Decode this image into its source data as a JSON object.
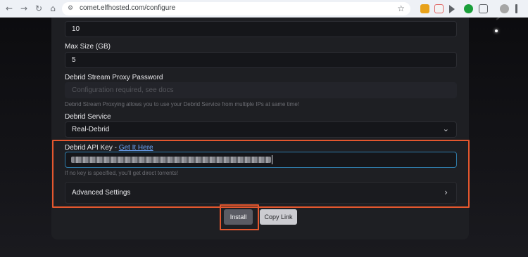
{
  "browser": {
    "url": "comet.elfhosted.com/configure",
    "back_glyph": "←",
    "forward_glyph": "→",
    "reload_glyph": "↻",
    "home_glyph": "⌂",
    "site_glyph": "⚙",
    "bookmark_glyph": "☆"
  },
  "form": {
    "top_field_value": "10",
    "max_size_label": "Max Size (GB)",
    "max_size_value": "5",
    "proxy_password_label": "Debrid Stream Proxy Password",
    "proxy_password_placeholder": "Configuration required, see docs",
    "proxy_hint": "Debrid Stream Proxying allows you to use your Debrid Service from multiple IPs at same time!",
    "debrid_service_label": "Debrid Service",
    "debrid_service_value": "Real-Debrid",
    "api_key_label": "Debrid API Key - ",
    "api_key_link": "Get It Here",
    "api_key_hint": "If no key is specified, you'll get direct torrents!",
    "advanced_settings_label": "Advanced Settings",
    "chevron_down": "⌄",
    "chevron_right": "›"
  },
  "actions": {
    "install_label": "Install",
    "copy_link_label": "Copy Link"
  },
  "colors": {
    "highlight": "#e4572e",
    "link": "#6fa8ff",
    "focus_border": "#2f7ba8"
  }
}
